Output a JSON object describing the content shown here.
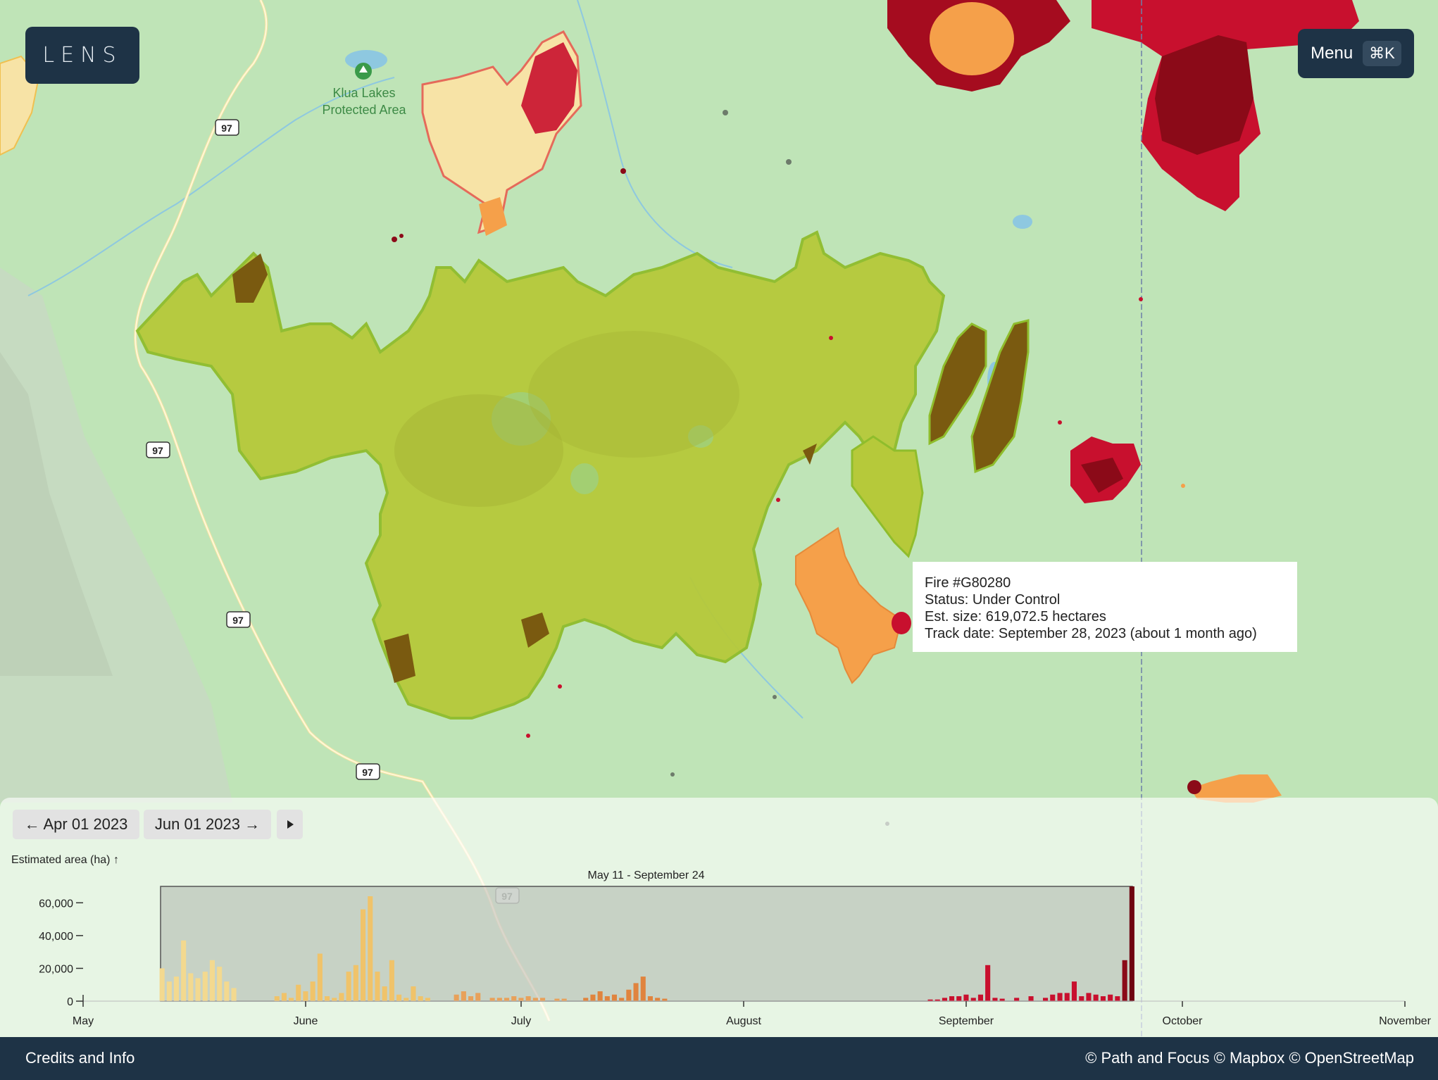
{
  "app": {
    "logo_text": "LENS"
  },
  "header": {
    "menu_label": "Menu",
    "menu_shortcut": "⌘K"
  },
  "map": {
    "place_label_line1": "Klua Lakes",
    "place_label_line2": "Protected Area",
    "highway_shields": [
      "97",
      "97",
      "97",
      "97",
      "97"
    ],
    "colors": {
      "land": "#bfe4b7",
      "fire_under_control": "#b6c93a",
      "fire_outline": "#8fbd2c",
      "fire_dark_red": "#8b0a18",
      "fire_red": "#c8102e",
      "fire_orange": "#f5a04a",
      "fire_pale": "#f7e3a6",
      "fire_brown": "#7a5a10"
    }
  },
  "tooltip": {
    "line1": "Fire #G80280",
    "line2": "Status: Under Control",
    "line3": "Est. size: 619,072.5 hectares",
    "line4": "Track date: September 28, 2023 (about 1 month ago)"
  },
  "timeline": {
    "prev_label": "← Apr 01 2023",
    "next_label": "Jun 01 2023 →",
    "play_icon": "play-icon",
    "y_axis_label": "Estimated area (ha) ↑",
    "selection_label": "May 11 - September 24",
    "y_ticks": [
      "60,000",
      "40,000",
      "20,000",
      "0"
    ],
    "x_ticks": [
      "May",
      "June",
      "July",
      "August",
      "September",
      "October",
      "November"
    ]
  },
  "chart_data": {
    "type": "bar",
    "ylabel": "Estimated area (ha) ↑",
    "ylim": [
      0,
      70000
    ],
    "x_range": [
      "May 1, 2023",
      "November 1, 2023"
    ],
    "selection": [
      "May 11",
      "September 24"
    ],
    "bars": [
      {
        "date": "2023-05-12",
        "value": 20000,
        "color": "#f3d98f"
      },
      {
        "date": "2023-05-13",
        "value": 12000,
        "color": "#f3d98f"
      },
      {
        "date": "2023-05-14",
        "value": 15000,
        "color": "#f3d98f"
      },
      {
        "date": "2023-05-15",
        "value": 37000,
        "color": "#f3d98f"
      },
      {
        "date": "2023-05-16",
        "value": 17000,
        "color": "#f3d98f"
      },
      {
        "date": "2023-05-17",
        "value": 14000,
        "color": "#f3d98f"
      },
      {
        "date": "2023-05-18",
        "value": 18000,
        "color": "#f3d98f"
      },
      {
        "date": "2023-05-19",
        "value": 25000,
        "color": "#f3d98f"
      },
      {
        "date": "2023-05-20",
        "value": 21000,
        "color": "#f3d98f"
      },
      {
        "date": "2023-05-21",
        "value": 12000,
        "color": "#f3d98f"
      },
      {
        "date": "2023-05-22",
        "value": 8000,
        "color": "#f3d98f"
      },
      {
        "date": "2023-05-28",
        "value": 3000,
        "color": "#f0c36a"
      },
      {
        "date": "2023-05-29",
        "value": 5000,
        "color": "#f0c36a"
      },
      {
        "date": "2023-05-30",
        "value": 2000,
        "color": "#f0c36a"
      },
      {
        "date": "2023-05-31",
        "value": 10000,
        "color": "#f0c36a"
      },
      {
        "date": "2023-06-01",
        "value": 6000,
        "color": "#f0c36a"
      },
      {
        "date": "2023-06-02",
        "value": 12000,
        "color": "#f0c36a"
      },
      {
        "date": "2023-06-03",
        "value": 29000,
        "color": "#f0c36a"
      },
      {
        "date": "2023-06-04",
        "value": 3000,
        "color": "#f0c36a"
      },
      {
        "date": "2023-06-05",
        "value": 2000,
        "color": "#f0c36a"
      },
      {
        "date": "2023-06-06",
        "value": 5000,
        "color": "#f0c36a"
      },
      {
        "date": "2023-06-07",
        "value": 18000,
        "color": "#f0c36a"
      },
      {
        "date": "2023-06-08",
        "value": 22000,
        "color": "#f0c36a"
      },
      {
        "date": "2023-06-09",
        "value": 56000,
        "color": "#f0c36a"
      },
      {
        "date": "2023-06-10",
        "value": 64000,
        "color": "#f0c36a"
      },
      {
        "date": "2023-06-11",
        "value": 18000,
        "color": "#f0c36a"
      },
      {
        "date": "2023-06-12",
        "value": 9000,
        "color": "#f0c36a"
      },
      {
        "date": "2023-06-13",
        "value": 25000,
        "color": "#f0c36a"
      },
      {
        "date": "2023-06-14",
        "value": 4000,
        "color": "#f0c36a"
      },
      {
        "date": "2023-06-15",
        "value": 2000,
        "color": "#f0c36a"
      },
      {
        "date": "2023-06-16",
        "value": 9000,
        "color": "#f0c36a"
      },
      {
        "date": "2023-06-17",
        "value": 3000,
        "color": "#f0c36a"
      },
      {
        "date": "2023-06-18",
        "value": 2000,
        "color": "#f0c36a"
      },
      {
        "date": "2023-06-22",
        "value": 4000,
        "color": "#e8a15a"
      },
      {
        "date": "2023-06-23",
        "value": 6000,
        "color": "#e8a15a"
      },
      {
        "date": "2023-06-24",
        "value": 3000,
        "color": "#e8a15a"
      },
      {
        "date": "2023-06-25",
        "value": 5000,
        "color": "#e8a15a"
      },
      {
        "date": "2023-06-27",
        "value": 2000,
        "color": "#e8a15a"
      },
      {
        "date": "2023-06-28",
        "value": 2000,
        "color": "#e8a15a"
      },
      {
        "date": "2023-06-29",
        "value": 2000,
        "color": "#e8a15a"
      },
      {
        "date": "2023-06-30",
        "value": 3000,
        "color": "#e8a15a"
      },
      {
        "date": "2023-07-01",
        "value": 2000,
        "color": "#e8a15a"
      },
      {
        "date": "2023-07-02",
        "value": 3000,
        "color": "#e8a15a"
      },
      {
        "date": "2023-07-03",
        "value": 2000,
        "color": "#e8a15a"
      },
      {
        "date": "2023-07-04",
        "value": 2000,
        "color": "#e8a15a"
      },
      {
        "date": "2023-07-06",
        "value": 1500,
        "color": "#e8a15a"
      },
      {
        "date": "2023-07-07",
        "value": 1500,
        "color": "#e8a15a"
      },
      {
        "date": "2023-07-10",
        "value": 2000,
        "color": "#e0843e"
      },
      {
        "date": "2023-07-11",
        "value": 4000,
        "color": "#e0843e"
      },
      {
        "date": "2023-07-12",
        "value": 6000,
        "color": "#e0843e"
      },
      {
        "date": "2023-07-13",
        "value": 3000,
        "color": "#e0843e"
      },
      {
        "date": "2023-07-14",
        "value": 4000,
        "color": "#e0843e"
      },
      {
        "date": "2023-07-15",
        "value": 2000,
        "color": "#e0843e"
      },
      {
        "date": "2023-07-16",
        "value": 7000,
        "color": "#e0843e"
      },
      {
        "date": "2023-07-17",
        "value": 11000,
        "color": "#e0843e"
      },
      {
        "date": "2023-07-18",
        "value": 15000,
        "color": "#e0843e"
      },
      {
        "date": "2023-07-19",
        "value": 3000,
        "color": "#e0843e"
      },
      {
        "date": "2023-07-20",
        "value": 2000,
        "color": "#e0843e"
      },
      {
        "date": "2023-07-21",
        "value": 1500,
        "color": "#e0843e"
      },
      {
        "date": "2023-08-27",
        "value": 1000,
        "color": "#c8102e"
      },
      {
        "date": "2023-08-28",
        "value": 1000,
        "color": "#c8102e"
      },
      {
        "date": "2023-08-29",
        "value": 2000,
        "color": "#c8102e"
      },
      {
        "date": "2023-08-30",
        "value": 3000,
        "color": "#c8102e"
      },
      {
        "date": "2023-08-31",
        "value": 3000,
        "color": "#c8102e"
      },
      {
        "date": "2023-09-01",
        "value": 4000,
        "color": "#c8102e"
      },
      {
        "date": "2023-09-02",
        "value": 2000,
        "color": "#c8102e"
      },
      {
        "date": "2023-09-03",
        "value": 4000,
        "color": "#c8102e"
      },
      {
        "date": "2023-09-04",
        "value": 22000,
        "color": "#c8102e"
      },
      {
        "date": "2023-09-05",
        "value": 2000,
        "color": "#c8102e"
      },
      {
        "date": "2023-09-06",
        "value": 1500,
        "color": "#c8102e"
      },
      {
        "date": "2023-09-08",
        "value": 2000,
        "color": "#c8102e"
      },
      {
        "date": "2023-09-10",
        "value": 3000,
        "color": "#c8102e"
      },
      {
        "date": "2023-09-12",
        "value": 2000,
        "color": "#c8102e"
      },
      {
        "date": "2023-09-13",
        "value": 4000,
        "color": "#c8102e"
      },
      {
        "date": "2023-09-14",
        "value": 5000,
        "color": "#c8102e"
      },
      {
        "date": "2023-09-15",
        "value": 5000,
        "color": "#c8102e"
      },
      {
        "date": "2023-09-16",
        "value": 12000,
        "color": "#c8102e"
      },
      {
        "date": "2023-09-17",
        "value": 3000,
        "color": "#c8102e"
      },
      {
        "date": "2023-09-18",
        "value": 5000,
        "color": "#c8102e"
      },
      {
        "date": "2023-09-19",
        "value": 4000,
        "color": "#c8102e"
      },
      {
        "date": "2023-09-20",
        "value": 3000,
        "color": "#c8102e"
      },
      {
        "date": "2023-09-21",
        "value": 4000,
        "color": "#c8102e"
      },
      {
        "date": "2023-09-22",
        "value": 3000,
        "color": "#c8102e"
      },
      {
        "date": "2023-09-23",
        "value": 25000,
        "color": "#8b0a18"
      },
      {
        "date": "2023-09-24",
        "value": 70000,
        "color": "#6e0510"
      }
    ]
  },
  "footer": {
    "credits_label": "Credits and Info",
    "attribution": "© Path and Focus © Mapbox © OpenStreetMap"
  }
}
